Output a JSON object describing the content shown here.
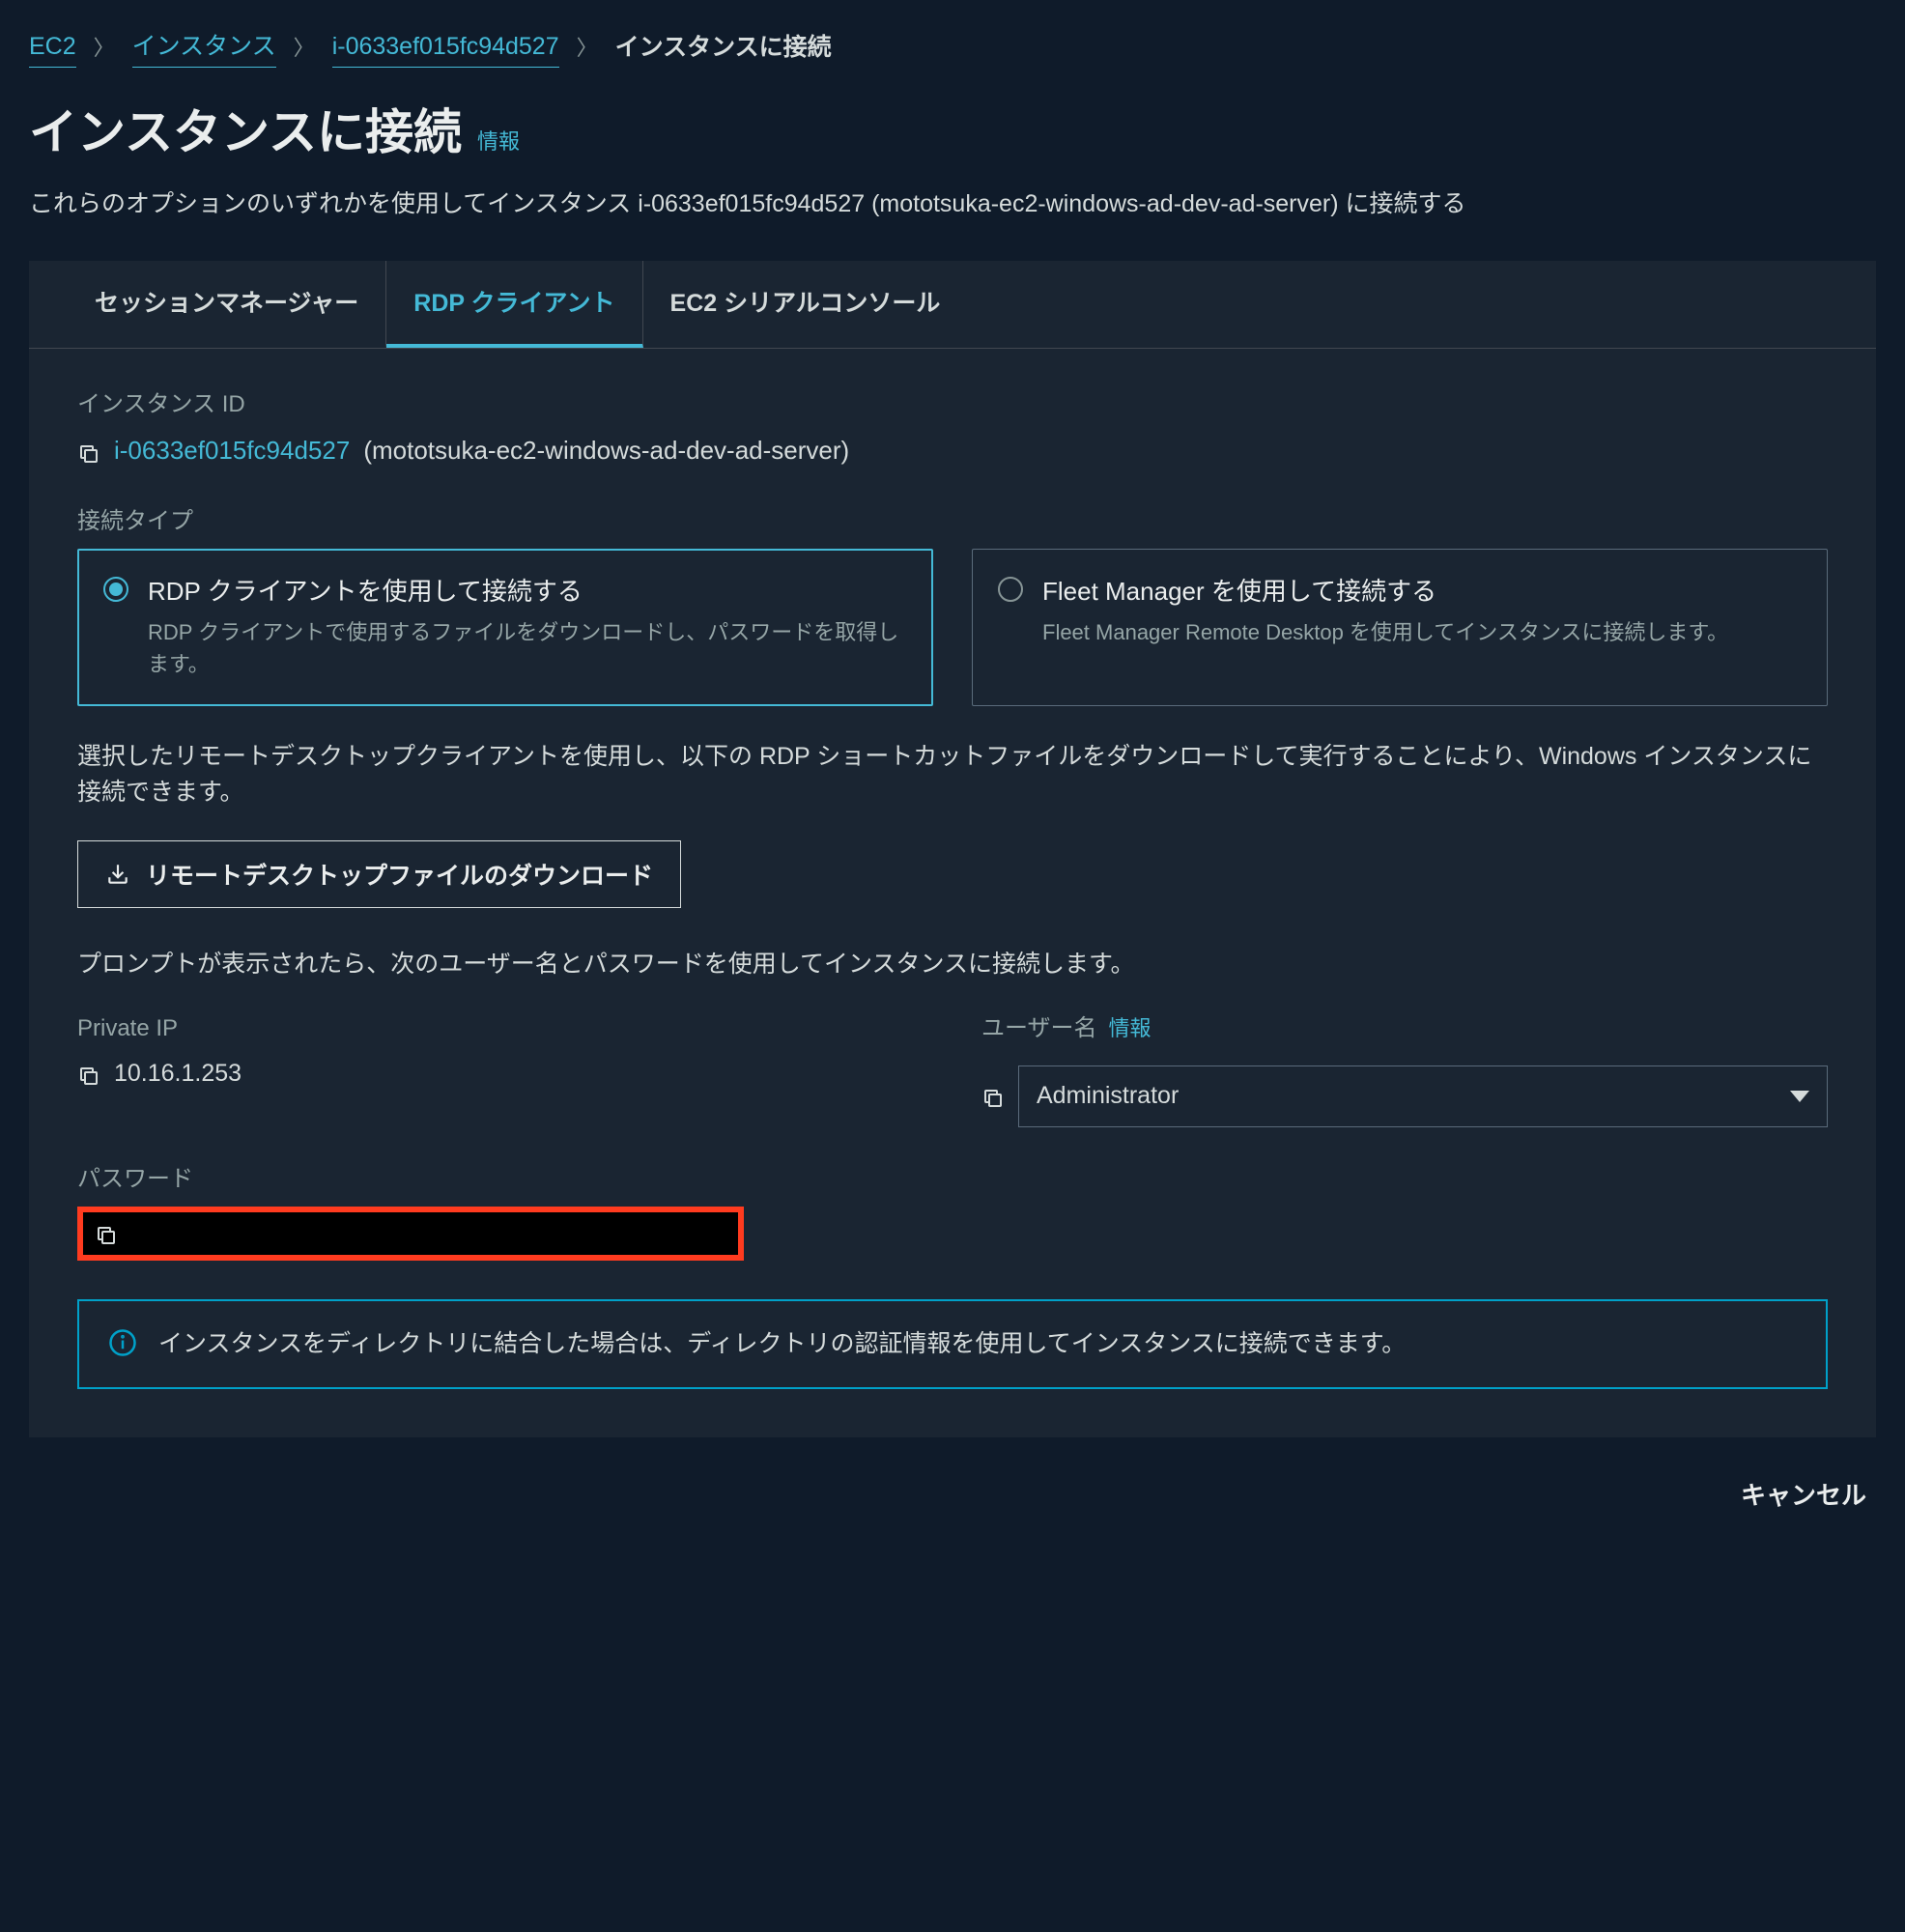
{
  "breadcrumb": {
    "items": [
      "EC2",
      "インスタンス",
      "i-0633ef015fc94d527"
    ],
    "current": "インスタンスに接続"
  },
  "header": {
    "title": "インスタンスに接続",
    "info": "情報",
    "description": "これらのオプションのいずれかを使用してインスタンス i-0633ef015fc94d527 (mototsuka-ec2-windows-ad-dev-ad-server) に接続する"
  },
  "tabs": [
    "セッションマネージャー",
    "RDP クライアント",
    "EC2 シリアルコンソール"
  ],
  "fields": {
    "instance_id_label": "インスタンス ID",
    "instance_id": "i-0633ef015fc94d527",
    "instance_name": "(mototsuka-ec2-windows-ad-dev-ad-server)",
    "connection_type_label": "接続タイプ"
  },
  "radios": [
    {
      "title": "RDP クライアントを使用して接続する",
      "desc": "RDP クライアントで使用するファイルをダウンロードし、パスワードを取得します。"
    },
    {
      "title": "Fleet Manager を使用して接続する",
      "desc": "Fleet Manager Remote Desktop を使用してインスタンスに接続します。"
    }
  ],
  "body_text1": "選択したリモートデスクトップクライアントを使用し、以下の RDP ショートカットファイルをダウンロードして実行することにより、Windows インスタンスに接続できます。",
  "download_button": "リモートデスクトップファイルのダウンロード",
  "body_text2": "プロンプトが表示されたら、次のユーザー名とパスワードを使用してインスタンスに接続します。",
  "private_ip_label": "Private IP",
  "private_ip": "10.16.1.253",
  "username_label": "ユーザー名",
  "username_info": "情報",
  "username_value": "Administrator",
  "password_label": "パスワード",
  "info_box": "インスタンスをディレクトリに結合した場合は、ディレクトリの認証情報を使用してインスタンスに接続できます。",
  "cancel": "キャンセル"
}
